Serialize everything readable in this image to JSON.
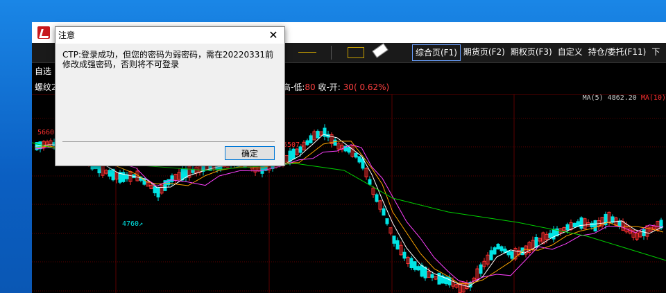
{
  "toolbar": {
    "nav": [
      "综合页(F1)",
      "期货页(F2)",
      "期权页(F3)",
      "自定义",
      "持仓/委托(F11)",
      "下"
    ]
  },
  "strip": {
    "first": "自选"
  },
  "chart_header": {
    "symbol": "螺纹2",
    "stat_prefix": "高-低:",
    "stat_range": "80",
    "stat_mid": " 收-开:",
    "stat_change": " 30( 0.62%)"
  },
  "ma_legend": {
    "ma5": "MA(5) 4862.20",
    "ma10": "MA(10)"
  },
  "chart_labels": {
    "high": "5660",
    "peak": "5507",
    "low": "4760"
  },
  "dialog": {
    "title": "注意",
    "message": "CTP:登录成功，但您的密码为弱密码，需在20220331前修改成强密码，否则将不可登录",
    "ok": "确定",
    "close": "✕"
  },
  "colors": {
    "up": "#ff3030",
    "down": "#00e5e5",
    "ma5": "#ffffff",
    "ma10": "#ffa500",
    "ma20": "#ff40ff",
    "ma60": "#00d000",
    "grid": "#5a0000"
  }
}
